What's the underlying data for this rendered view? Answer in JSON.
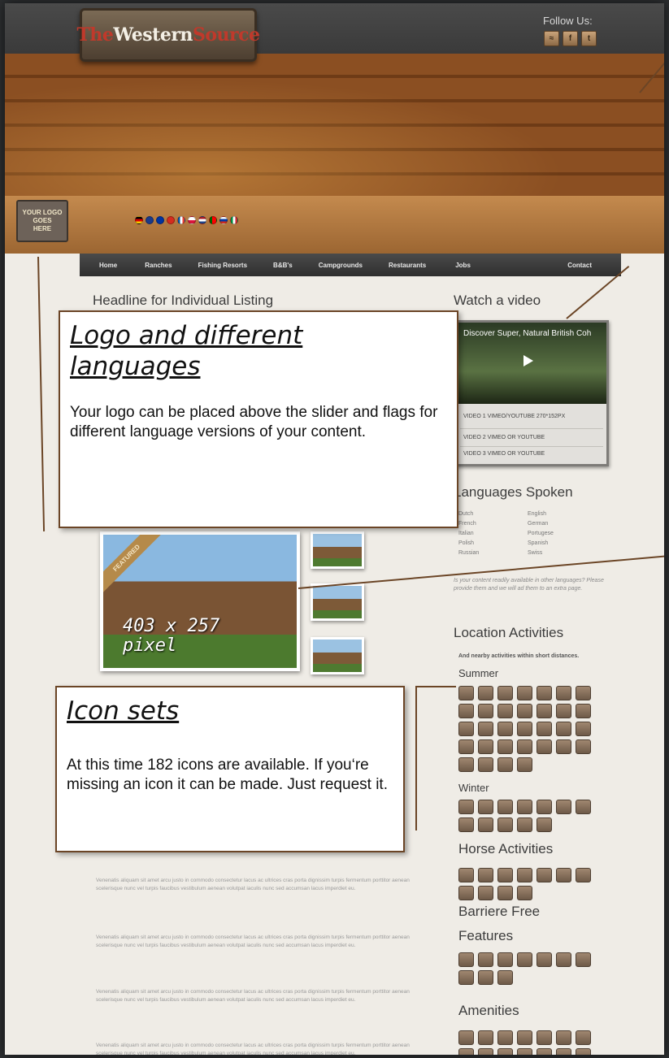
{
  "header": {
    "logo_part1": "The",
    "logo_part2": "Western",
    "logo_part3": "Source",
    "follow_label": "Follow Us:",
    "social_icons": [
      "rss-icon",
      "facebook-icon",
      "twitter-icon"
    ],
    "social_glyphs": [
      "≈",
      "f",
      "t"
    ],
    "your_logo": [
      "YOUR LOGO",
      "GOES",
      "HERE"
    ]
  },
  "nav": [
    "Home",
    "Ranches",
    "Fishing Resorts",
    "B&B's",
    "Campgrounds",
    "Restaurants",
    "Jobs",
    "Contact"
  ],
  "main": {
    "headline": "Headline for Individual Listing",
    "photo_badge": "FEATURED",
    "photo_size": "403 x 257 pixel",
    "lorem": "Venenatis aliquam sit amet arcu justo in commodo consectetur lacus ac ultrices cras porta dignissim turpis fermentum porttitor aenean scelerisque nunc vel turpis faucibus vestibulum aenean volutpat iaculis nunc sed accumsan lacus imperdiet eu."
  },
  "sidebar": {
    "video_heading": "Watch a video",
    "video_title": "Discover Super, Natural British Coh",
    "video_rows": [
      "VIDEO 1 VIMEO/YOUTUBE 270*152PX",
      "VIDEO 2 VIMEO OR YOUTUBE",
      "VIDEO 3 VIMEO OR YOUTUBE"
    ],
    "languages_heading": "Languages Spoken",
    "languages_left": [
      "Dutch",
      "French",
      "Italian",
      "Polish",
      "Russian"
    ],
    "languages_right": [
      "English",
      "German",
      "Portugese",
      "Spanish",
      "Swiss"
    ],
    "languages_note": "Is your content readily available in other languages? Please provide them and we will ad them to an extra page.",
    "activities_heading": "Location Activities",
    "activities_sub": "And nearby activities within short distances.",
    "summer_label": "Summer",
    "winter_label": "Winter",
    "horse_heading": "Horse Activities",
    "barriere_heading_1": "Barriere Free",
    "barriere_heading_2": "Features",
    "amenities_heading": "Amenities"
  },
  "callouts": {
    "logo_title": "Logo and different languages",
    "logo_body": "Your logo can be placed above the slider and flags for different language versions of your content.",
    "icons_title": "Icon sets",
    "icons_body": "At this time 182 icons are available. If you‘re missing an icon it can be made. Just request it."
  },
  "colors": {
    "accent": "#6b4526",
    "background": "#efece6",
    "nav": "#3a3a3a",
    "logo_red": "#c0392b"
  }
}
